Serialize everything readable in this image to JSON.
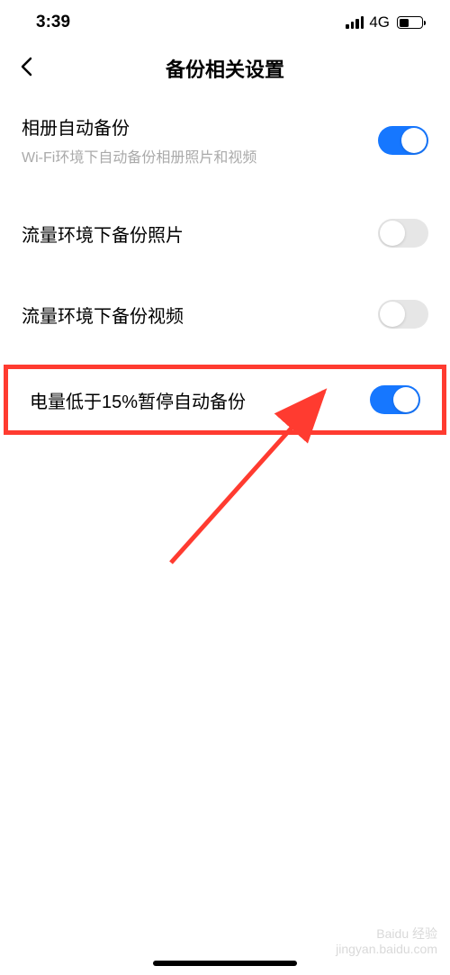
{
  "statusBar": {
    "time": "3:39",
    "network": "4G"
  },
  "header": {
    "title": "备份相关设置"
  },
  "settings": {
    "autoBackup": {
      "title": "相册自动备份",
      "subtitle": "Wi-Fi环境下自动备份相册照片和视频",
      "on": true
    },
    "cellularPhoto": {
      "title": "流量环境下备份照片",
      "on": false
    },
    "cellularVideo": {
      "title": "流量环境下备份视频",
      "on": false
    },
    "lowBattery": {
      "title": "电量低于15%暂停自动备份",
      "on": true
    }
  },
  "watermark": {
    "line1": "Baidu 经验",
    "line2": "jingyan.baidu.com"
  }
}
